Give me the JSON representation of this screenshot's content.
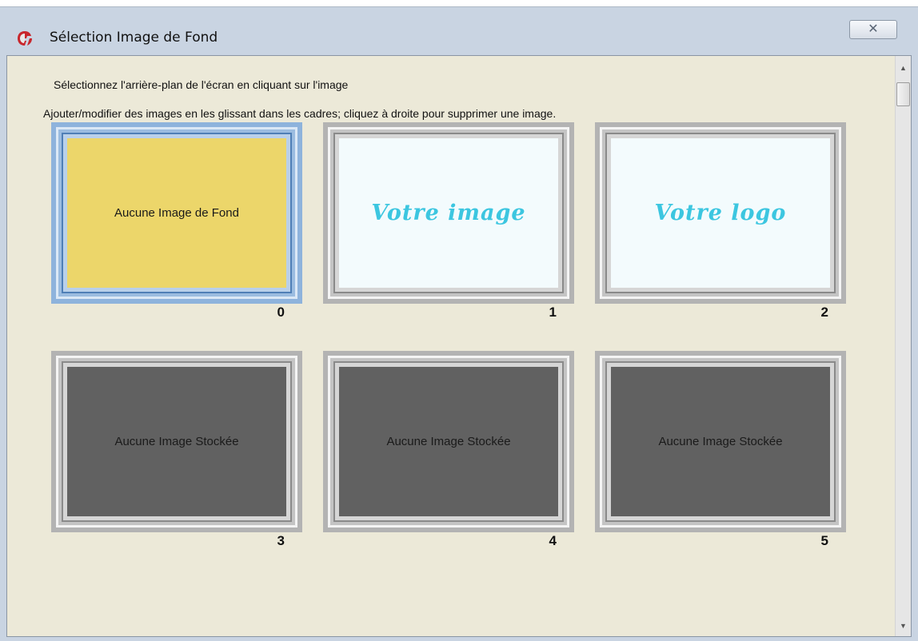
{
  "window": {
    "title": "Sélection Image de Fond",
    "close_symbol": "✕"
  },
  "instructions": {
    "line1": "Sélectionnez l'arrière-plan de l'écran en cliquant sur l'image",
    "line2": "Ajouter/modifier des images en les glissant dans les cadres; cliquez à droite pour supprimer une image."
  },
  "slots": [
    {
      "number": "0",
      "label": "Aucune Image de Fond",
      "fill": "#ecd66a",
      "selected": true
    },
    {
      "number": "1",
      "label": "Votre image",
      "fill": "#f3fbfd",
      "selected": false
    },
    {
      "number": "2",
      "label": "Votre logo",
      "fill": "#f3fbfd",
      "selected": false
    },
    {
      "number": "3",
      "label": "Aucune Image Stockée",
      "fill": "#616161",
      "selected": false
    },
    {
      "number": "4",
      "label": "Aucune Image Stockée",
      "fill": "#616161",
      "selected": false
    },
    {
      "number": "5",
      "label": "Aucune Image Stockée",
      "fill": "#616161",
      "selected": false
    }
  ],
  "scrollbar": {
    "up_symbol": "▲",
    "down_symbol": "▼"
  },
  "colors": {
    "selection_accent": "#8eb3dc",
    "script_text": "#3cc6e0"
  }
}
